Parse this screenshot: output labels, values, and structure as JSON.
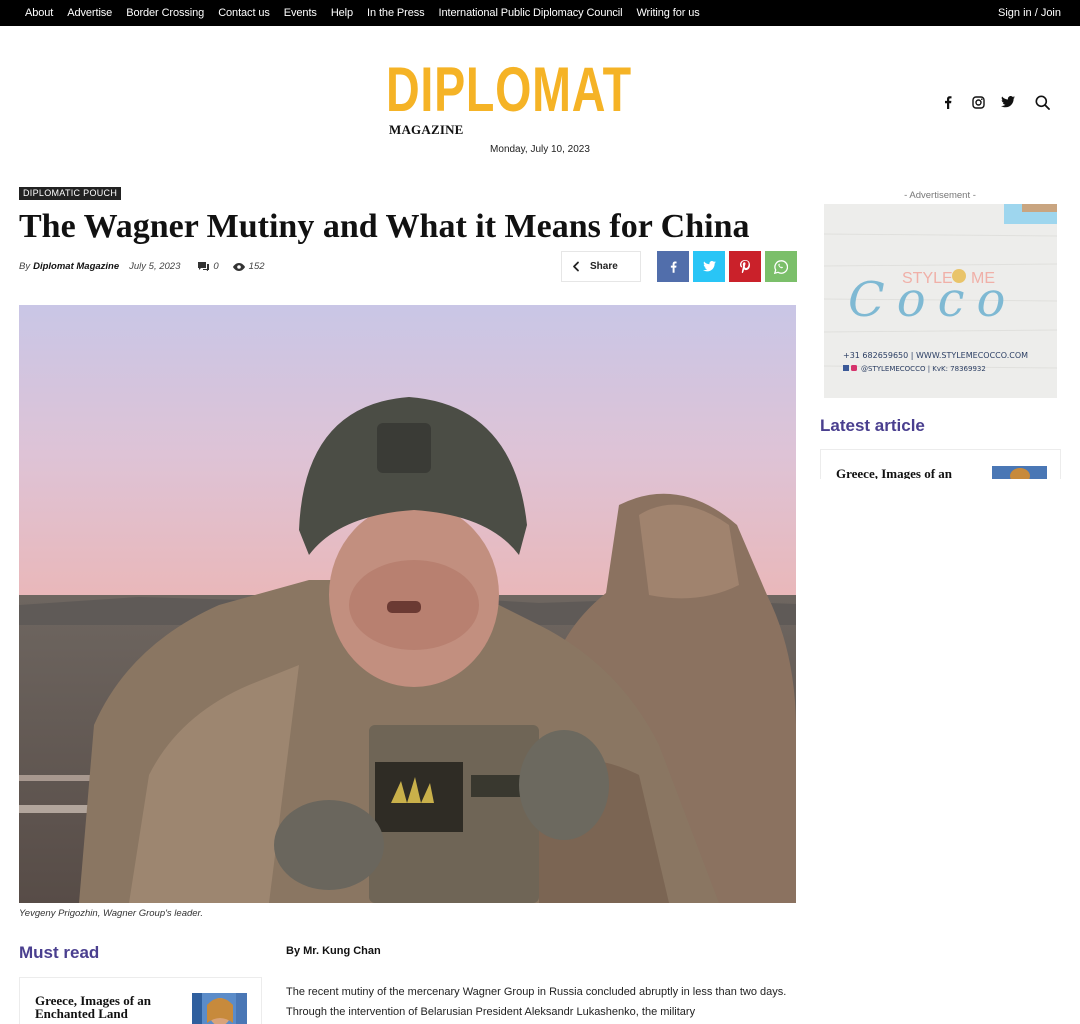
{
  "topbar": {
    "links": [
      "About",
      "Advertise",
      "Border Crossing",
      "Contact us",
      "Events",
      "Help",
      "In the Press",
      "International Public Diplomacy Council",
      "Writing for us"
    ],
    "signin_label": "Sign in / Join"
  },
  "header": {
    "logo_text": "DIPLOMAT",
    "logo_subtext": "MAGAZINE",
    "date": "Monday, July 10, 2023",
    "social_icons": [
      "facebook-icon",
      "instagram-icon",
      "twitter-icon",
      "search-icon"
    ]
  },
  "article": {
    "category": "DIPLOMATIC POUCH",
    "title": "The Wagner Mutiny and What it Means for China",
    "by_label": "By",
    "author": "Diplomat Magazine",
    "published": "July 5, 2023",
    "comments": "0",
    "views": "152",
    "share_label": "Share",
    "image_caption": "Yevgeny Prigozhin, Wagner Group's leader.",
    "byline": "By Mr. Kung Chan",
    "body": "The recent mutiny of the mercenary Wagner Group in Russia concluded abruptly in less than two days. Through the intervention of Belarusian President Aleksandr Lukashenko, the military"
  },
  "must_read": {
    "title": "Must read",
    "card_title": "Greece, Images of an Enchanted Land"
  },
  "sidebar": {
    "ad_label": "- Advertisement -",
    "ad": {
      "brand_top": "STYLE",
      "brand_me": "ME",
      "brand_script": "Coco",
      "contact_line": "+31 682659650 | WWW.STYLEMECOCCO.COM",
      "social_line": "@STYLEMECOCCO | KvK: 78369932"
    },
    "latest_title": "Latest article",
    "latest_card_title": "Greece, Images of an"
  },
  "colors": {
    "accent": "#4a3f8f",
    "logo": "#f5b326",
    "facebook": "#516eab",
    "twitter": "#29c5f6",
    "pinterest": "#ca212a",
    "whatsapp": "#7bbf6a"
  }
}
